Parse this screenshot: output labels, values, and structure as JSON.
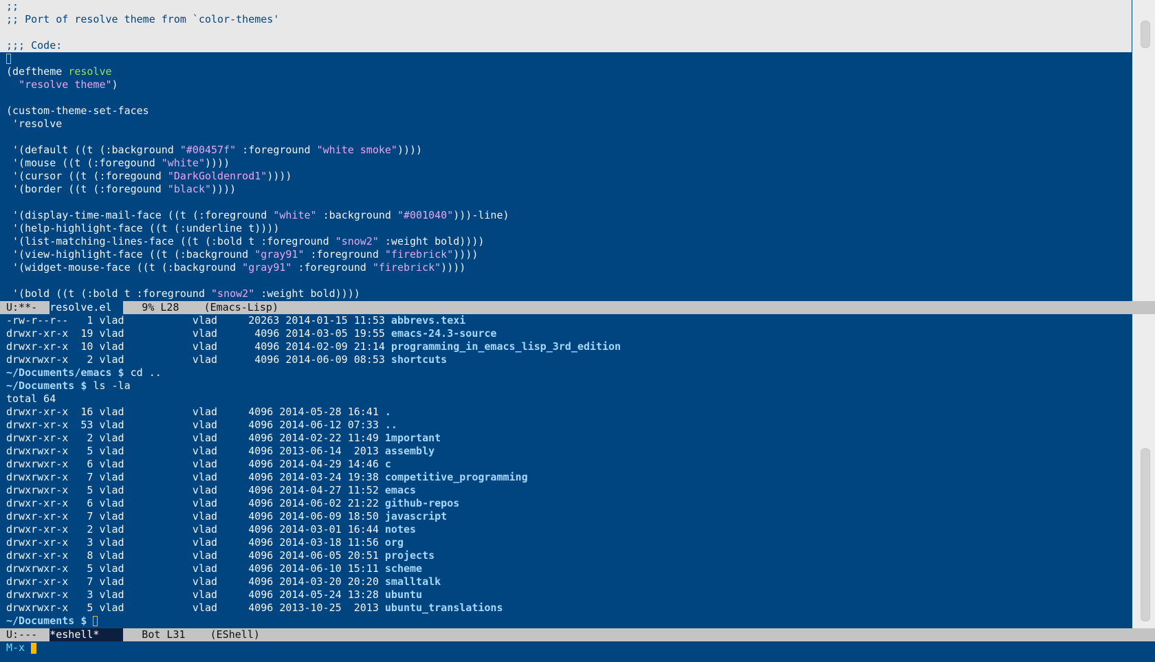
{
  "code_header": [
    ";;",
    ";; Port of resolve theme from `color-themes'",
    "",
    ";;; Code:"
  ],
  "code_lines": [
    [],
    [
      {
        "t": "(deftheme "
      },
      {
        "t": "resolve",
        "c": "fn"
      }
    ],
    [
      {
        "t": "  "
      },
      {
        "t": "\"resolve theme\"",
        "c": "s"
      },
      {
        "t": ")"
      }
    ],
    [],
    [
      {
        "t": "(custom-theme-set-faces"
      }
    ],
    [
      {
        "t": " 'resolve"
      }
    ],
    [],
    [
      {
        "t": " '(default ((t (:background "
      },
      {
        "t": "\"#00457f\"",
        "c": "s"
      },
      {
        "t": " :foreground "
      },
      {
        "t": "\"white smoke\"",
        "c": "s"
      },
      {
        "t": "))))"
      }
    ],
    [
      {
        "t": " '(mouse ((t (:foregound "
      },
      {
        "t": "\"white\"",
        "c": "s"
      },
      {
        "t": "))))"
      }
    ],
    [
      {
        "t": " '(cursor ((t (:foregound "
      },
      {
        "t": "\"DarkGoldenrod1\"",
        "c": "s"
      },
      {
        "t": "))))"
      }
    ],
    [
      {
        "t": " '(border ((t (:foregound "
      },
      {
        "t": "\"black\"",
        "c": "s"
      },
      {
        "t": "))))"
      }
    ],
    [],
    [
      {
        "t": " '(display-time-mail-face ((t (:foreground "
      },
      {
        "t": "\"white\"",
        "c": "s"
      },
      {
        "t": " :background "
      },
      {
        "t": "\"#001040\"",
        "c": "s"
      },
      {
        "t": ")))-line)"
      }
    ],
    [
      {
        "t": " '(help-highlight-face ((t (:underline t))))"
      }
    ],
    [
      {
        "t": " '(list-matching-lines-face ((t (:bold t :foreground "
      },
      {
        "t": "\"snow2\"",
        "c": "s"
      },
      {
        "t": " :weight bold))))"
      }
    ],
    [
      {
        "t": " '(view-highlight-face ((t (:background "
      },
      {
        "t": "\"gray91\"",
        "c": "s"
      },
      {
        "t": " :foreground "
      },
      {
        "t": "\"firebrick\"",
        "c": "s"
      },
      {
        "t": "))))"
      }
    ],
    [
      {
        "t": " '(widget-mouse-face ((t (:background "
      },
      {
        "t": "\"gray91\"",
        "c": "s"
      },
      {
        "t": " :foreground "
      },
      {
        "t": "\"firebrick\"",
        "c": "s"
      },
      {
        "t": "))))"
      }
    ],
    [],
    [
      {
        "t": " '(bold ((t (:bold t :foreground "
      },
      {
        "t": "\"snow2\"",
        "c": "s"
      },
      {
        "t": " :weight bold))))"
      }
    ]
  ],
  "modeline_top": {
    "status": "U:**-  ",
    "buffer": "resolve.el",
    "position": "   9% L28    ",
    "mode": "(Emacs-Lisp)"
  },
  "shell_lines": [
    {
      "type": "entry",
      "text": "-rw-r--r--   1 vlad           vlad     20263 2014-01-15 11:53 ",
      "name": "abbrevs.texi"
    },
    {
      "type": "entry",
      "text": "drwxr-xr-x  19 vlad           vlad      4096 2014-03-05 19:55 ",
      "name": "emacs-24.3-source"
    },
    {
      "type": "entry",
      "text": "drwxr-xr-x  10 vlad           vlad      4096 2014-02-09 21:14 ",
      "name": "programming_in_emacs_lisp_3rd_edition"
    },
    {
      "type": "entry",
      "text": "drwxrwxr-x   2 vlad           vlad      4096 2014-06-09 08:53 ",
      "name": "shortcuts"
    },
    {
      "type": "prompt",
      "prompt": "~/Documents/emacs $",
      "cmd": " cd .."
    },
    {
      "type": "prompt",
      "prompt": "~/Documents $",
      "cmd": " ls -la"
    },
    {
      "type": "text",
      "text": "total 64"
    },
    {
      "type": "entry",
      "text": "drwxr-xr-x  16 vlad           vlad     4096 2014-05-28 16:41 ",
      "name": "."
    },
    {
      "type": "entry",
      "text": "drwxr-xr-x  53 vlad           vlad     4096 2014-06-12 07:33 ",
      "name": ".."
    },
    {
      "type": "entry",
      "text": "drwxr-xr-x   2 vlad           vlad     4096 2014-02-22 11:49 ",
      "name": "1mportant"
    },
    {
      "type": "entry",
      "text": "drwxrwxr-x   5 vlad           vlad     4096 2013-06-14  2013 ",
      "name": "assembly"
    },
    {
      "type": "entry",
      "text": "drwxrwxr-x   6 vlad           vlad     4096 2014-04-29 14:46 ",
      "name": "c"
    },
    {
      "type": "entry",
      "text": "drwxrwxr-x   7 vlad           vlad     4096 2014-03-24 19:38 ",
      "name": "competitive_programming"
    },
    {
      "type": "entry",
      "text": "drwxrwxr-x   5 vlad           vlad     4096 2014-04-27 11:52 ",
      "name": "emacs"
    },
    {
      "type": "entry",
      "text": "drwxr-xr-x   6 vlad           vlad     4096 2014-06-02 21:22 ",
      "name": "github-repos"
    },
    {
      "type": "entry",
      "text": "drwxr-xr-x   7 vlad           vlad     4096 2014-06-09 18:50 ",
      "name": "javascript"
    },
    {
      "type": "entry",
      "text": "drwxr-xr-x   2 vlad           vlad     4096 2014-03-01 16:44 ",
      "name": "notes"
    },
    {
      "type": "entry",
      "text": "drwxr-xr-x   3 vlad           vlad     4096 2014-03-18 11:56 ",
      "name": "org"
    },
    {
      "type": "entry",
      "text": "drwxr-xr-x   8 vlad           vlad     4096 2014-06-05 20:51 ",
      "name": "projects"
    },
    {
      "type": "entry",
      "text": "drwxrwxr-x   5 vlad           vlad     4096 2014-06-10 15:11 ",
      "name": "scheme"
    },
    {
      "type": "entry",
      "text": "drwxr-xr-x   7 vlad           vlad     4096 2014-03-20 20:20 ",
      "name": "smalltalk"
    },
    {
      "type": "entry",
      "text": "drwxrwxr-x   3 vlad           vlad     4096 2014-05-24 13:28 ",
      "name": "ubuntu"
    },
    {
      "type": "entry",
      "text": "drwxrwxr-x   5 vlad           vlad     4096 2013-10-25  2013 ",
      "name": "ubuntu_translations"
    }
  ],
  "shell_prompt": "~/Documents $",
  "modeline_bottom": {
    "status": "U:---  ",
    "buffer": "*eshell*",
    "position": "   Bot L31    ",
    "mode": "(EShell)"
  },
  "minibuffer": {
    "text": "M-x "
  },
  "colors": {
    "background": "#00457f",
    "foreground": "#f5f5f5",
    "string": "#e6a8f0",
    "function_name": "#98e05a",
    "directory": "#a8d8ff",
    "cursor": "#ffb800"
  }
}
